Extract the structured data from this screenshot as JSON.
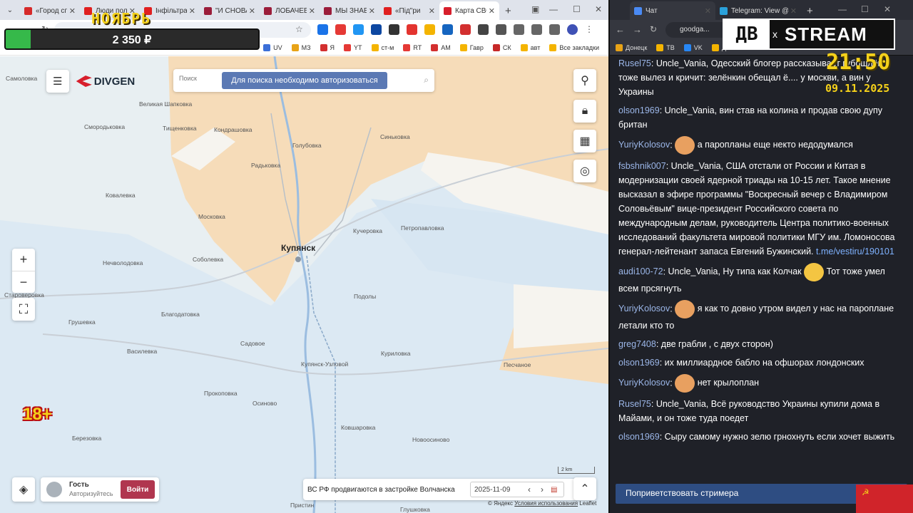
{
  "left_browser": {
    "tabs": [
      {
        "title": "«Город сп",
        "color": "#d62a2a"
      },
      {
        "title": "Люди пол",
        "color": "#e02020"
      },
      {
        "title": "Інфільтра",
        "color": "#e02020"
      },
      {
        "title": "\"И СНОВА",
        "color": "#9b1d3a"
      },
      {
        "title": "ЛОБАЧЕВ",
        "color": "#9b1d3a"
      },
      {
        "title": "МЫ ЗНАЕ",
        "color": "#9b1d3a"
      },
      {
        "title": "«Під\"ри",
        "color": "#e02020"
      },
      {
        "title": "Карта СВС",
        "color": "#d71f2c",
        "active": true
      }
    ],
    "bookmarks": [
      {
        "label": "UV"
      },
      {
        "label": "МЗ"
      },
      {
        "label": "Я"
      },
      {
        "label": "YT"
      },
      {
        "label": "ст-м"
      },
      {
        "label": "RT"
      },
      {
        "label": "AM"
      },
      {
        "label": "Гавр"
      },
      {
        "label": "СК"
      },
      {
        "label": "авт"
      },
      {
        "label": "Все закладки"
      }
    ]
  },
  "overlay": {
    "goal_title": "НОЯБРЬ",
    "goal_amount": "2 350 ₽",
    "goal_progress": 0.1,
    "age_label": "18+",
    "logo_left": "ДВ",
    "logo_right": "STREAM",
    "logo_x": "x",
    "clock": "21:50",
    "date": "09.11.2025"
  },
  "map": {
    "brand": "DIVGEN",
    "search_placeholder": "Поиск",
    "auth_banner": "Для поиска необходимо авторизоваться",
    "places": [
      "Самоловка",
      "Великая Шапковка",
      "Тищенковка",
      "Кондрашовка",
      "Смородьковка",
      "Голубовка",
      "Синьковка",
      "Радьковка",
      "Ковалевка",
      "Московка",
      "Кучеровка",
      "Петропавловка",
      "Купянск",
      "Соболевка",
      "Нечволодовка",
      "Староверовка",
      "Подолы",
      "Благодатовка",
      "Грушевка",
      "Садовое",
      "Куриловка",
      "Купянск-Узловой",
      "Песчаное",
      "Василевка",
      "Прокоповка",
      "Осиново",
      "Ковшаровка",
      "Березовка",
      "Новоосиново",
      "Пристин",
      "Глушковка"
    ],
    "guest_name": "Гость",
    "guest_sub": "Авторизуйтесь",
    "login_label": "Войти",
    "footer_text": "ВС РФ продвигаются в застройке Волчанска",
    "footer_date": "2025-11-09",
    "scale_label": "2 km",
    "attribution": "© Яндекс",
    "terms": "Условия использования",
    "leaflet": "Leaflet"
  },
  "right_browser": {
    "tabs": [
      {
        "title": "Чат",
        "color": "#4a8af4",
        "active": true
      },
      {
        "title": "Telegram: View @infa",
        "color": "#2aa1da"
      }
    ],
    "url": "goodga...",
    "bookmarks": [
      {
        "label": "Донецк"
      },
      {
        "label": "ТВ"
      },
      {
        "label": "VK"
      },
      {
        "label": "Д"
      }
    ]
  },
  "chat": {
    "messages": [
      {
        "nick": "Rusel75",
        "text": "Uncle_Vania, Одесский блогер рассказывает губошлёп тоже вылез и кричит: зелёнкин обещал ё.... у москви, а вин у Украины"
      },
      {
        "nick": "olson1969",
        "text": "Uncle_Vania, вин став на колина и продав свою дупу британ"
      },
      {
        "nick": "YuriyKolosov",
        "text": "а паропланы еще некто недодумался",
        "emoji": true
      },
      {
        "nick": "fsbshnik007",
        "text": "Uncle_Vania, США отстали от России и Китая в модернизации своей ядерной триады на 10-15 лет. Такое мнение высказал в эфире программы \"Воскресный вечер с Владимиром Соловьёвым\" вице-президент Российского совета по международным делам, руководитель Центра политико-военных исследований факультета мировой политики МГУ им. Ломоносова генерал-лейтенант запаса Евгений Бужинский.",
        "link": "t.me/vestiru/190101"
      },
      {
        "nick": "audi100-72",
        "text": "Uncle_Vania, Ну типа как Колчак",
        "after": "Тот тоже умел всем прсягнуть",
        "emoji": true
      },
      {
        "nick": "YuriyKolosov",
        "text": "я как то довно утром видел у нас на пароплане летали кто то",
        "emoji": true
      },
      {
        "nick": "greg7408",
        "text": "две грабли , с двух сторон)"
      },
      {
        "nick": "olson1969",
        "text": "их миллиардное бабло на офшорах лондонских"
      },
      {
        "nick": "YuriyKolosov",
        "text": "нет крылоплан",
        "emoji": true
      },
      {
        "nick": "Rusel75",
        "text": "Uncle_Vania, Всё руководство Украины купили дома в Майами, и он тоже туда поедет"
      },
      {
        "nick": "olson1969",
        "text": "Сыру самому нужно зелю грнохнуть если хочет выжить"
      }
    ],
    "input_placeholder": "Поприветствовать стримера",
    "flag_symbol": "☭"
  }
}
